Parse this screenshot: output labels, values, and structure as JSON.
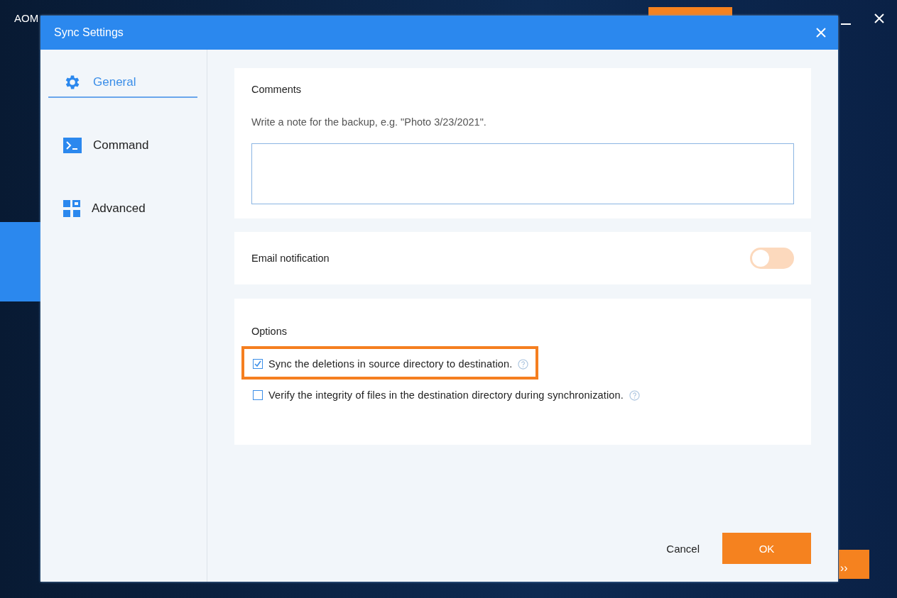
{
  "app": {
    "title": "AOM",
    "next_button": "››"
  },
  "dialog": {
    "title": "Sync Settings",
    "tabs": [
      {
        "label": "General",
        "kind": "gear",
        "selected": true
      },
      {
        "label": "Command",
        "kind": "terminal",
        "selected": false
      },
      {
        "label": "Advanced",
        "kind": "grid",
        "selected": false
      }
    ],
    "comments": {
      "label": "Comments",
      "hint": "Write a note for the backup, e.g. \"Photo 3/23/2021\"."
    },
    "email": {
      "label": "Email notification",
      "on": false
    },
    "options": {
      "label": "Options",
      "items": [
        {
          "label": "Sync the deletions in source directory to destination.",
          "checked": true,
          "highlighted": true
        },
        {
          "label": "Verify the integrity of files in the destination directory during synchronization.",
          "checked": false,
          "highlighted": false
        }
      ]
    },
    "buttons": [
      {
        "label": "Cancel",
        "kind": "text"
      },
      {
        "label": "OK",
        "kind": "primary"
      }
    ]
  }
}
